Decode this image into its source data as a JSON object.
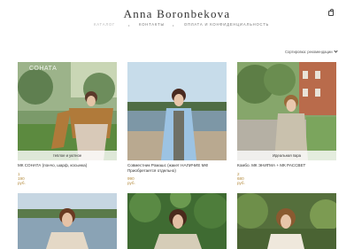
{
  "site": {
    "title": "Anna Boronbekova"
  },
  "nav": {
    "items": [
      "Каталог",
      "Контакты",
      "Оплата и конфиденциальность"
    ]
  },
  "sort": {
    "label": "Сортировка: рекомендации"
  },
  "products": [
    {
      "watermark": "СОНАТА",
      "badge": "теплое и уютное",
      "title": "МК СОНАТА (пончо, шарф, косынка)",
      "price": "1 190 руб."
    },
    {
      "watermark": "",
      "badge": "",
      "title": "Совместник Ромашс (жакет НАЛИЧИЕ МК! Приобретается отдельно)",
      "price": "990 руб."
    },
    {
      "watermark": "",
      "badge": "Идеальная пара",
      "title": "Комбо. МК ЭНИГМА + МК РАССВЕТ",
      "price": "2 680 руб."
    },
    {
      "watermark": "",
      "badge": "",
      "title": "",
      "price": ""
    },
    {
      "watermark": "",
      "badge": "",
      "title": "",
      "price": ""
    },
    {
      "watermark": "",
      "badge": "",
      "title": "",
      "price": ""
    }
  ],
  "colors": {
    "price": "#b48a3c",
    "accent": "#333333"
  }
}
